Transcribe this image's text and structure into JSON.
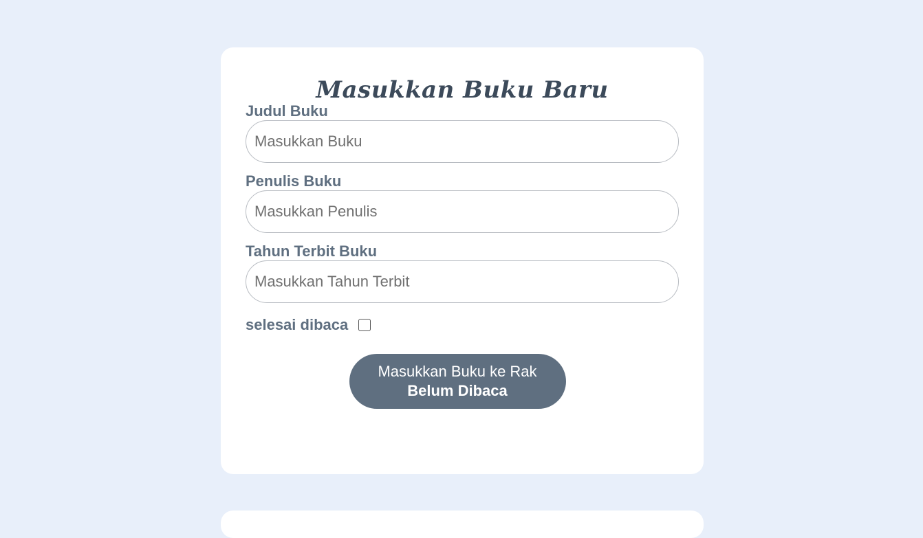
{
  "form": {
    "title": "Masukkan Buku Baru",
    "fields": [
      {
        "label": "Judul Buku",
        "placeholder": "Masukkan Buku",
        "value": ""
      },
      {
        "label": "Penulis Buku",
        "placeholder": "Masukkan Penulis",
        "value": ""
      },
      {
        "label": "Tahun Terbit Buku",
        "placeholder": "Masukkan Tahun Terbit",
        "value": ""
      }
    ],
    "checkbox": {
      "label": "selesai dibaca",
      "checked": false
    },
    "submit": {
      "line1": "Masukkan Buku ke Rak",
      "line2": "Belum Dibaca"
    }
  }
}
